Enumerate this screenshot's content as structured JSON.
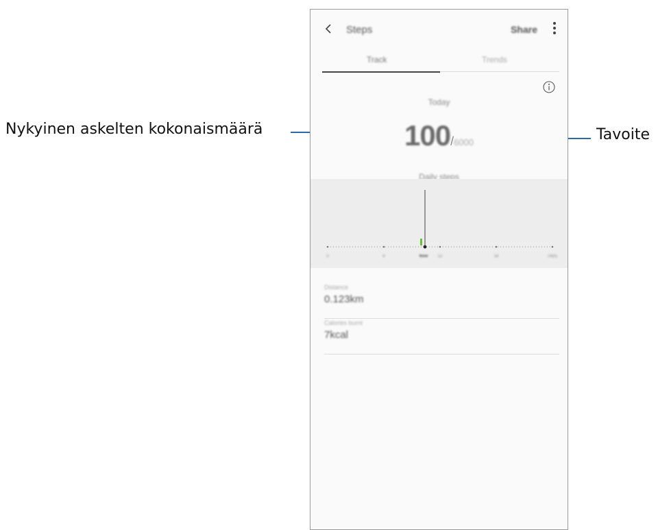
{
  "annotations": {
    "current_steps_label": "Nykyinen askelten kokonaismäärä",
    "goal_label": "Tavoite"
  },
  "app_bar": {
    "title": "Steps",
    "share_label": "Share"
  },
  "tabs": [
    {
      "label": "Track",
      "selected": true
    },
    {
      "label": "Trends",
      "selected": false
    }
  ],
  "summary": {
    "period_label": "Today",
    "current_steps": "100",
    "separator": "/",
    "goal_steps": "6000",
    "caption": "Daily steps"
  },
  "timeline": {
    "ticks": [
      "0",
      "6",
      "Now",
      "12",
      "18",
      "24(h)"
    ]
  },
  "stats": {
    "distance_label": "Distance",
    "distance_value": "0.123km",
    "calories_label": "Calories burnt",
    "calories_value": "7kcal"
  },
  "colors": {
    "accent": "#2b6aa8",
    "step_bar": "#6cbf3c"
  }
}
